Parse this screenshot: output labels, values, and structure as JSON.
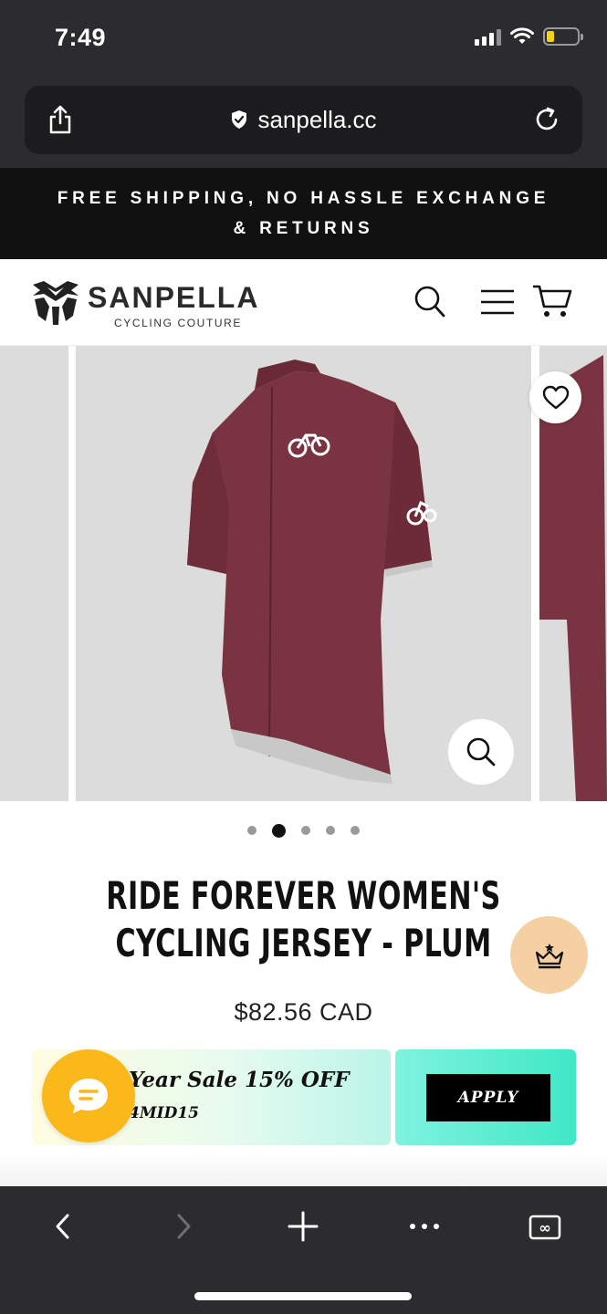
{
  "status_bar": {
    "time": "7:49",
    "battery_level": 0.15,
    "battery_color": "#f7d117"
  },
  "browser": {
    "url": "sanpella.cc",
    "icons": [
      "share-icon",
      "shield-icon",
      "reload-icon"
    ]
  },
  "announcement": {
    "line1": "FREE SHIPPING, NO HASSLE EXCHANGE",
    "line2": "& RETURNS"
  },
  "header": {
    "brand": "SANPELLA",
    "tagline": "CYCLING COUTURE",
    "icons": [
      "search-icon",
      "menu-icon",
      "cart-icon"
    ]
  },
  "gallery": {
    "slide_count": 5,
    "active_index": 1,
    "jersey_color": "#7a3340"
  },
  "product": {
    "title": "RIDE FOREVER WOMEN'S CYCLING JERSEY - PLUM",
    "price": "$82.56 CAD"
  },
  "coupon": {
    "title": "Year Sale 15% OFF",
    "code": "4MID15",
    "button_label": "APPLY"
  },
  "toolbar": {
    "icons": [
      "back-icon",
      "forward-icon",
      "new-tab-icon",
      "more-icon",
      "tabs-icon"
    ],
    "tabs_badge": "∞"
  }
}
